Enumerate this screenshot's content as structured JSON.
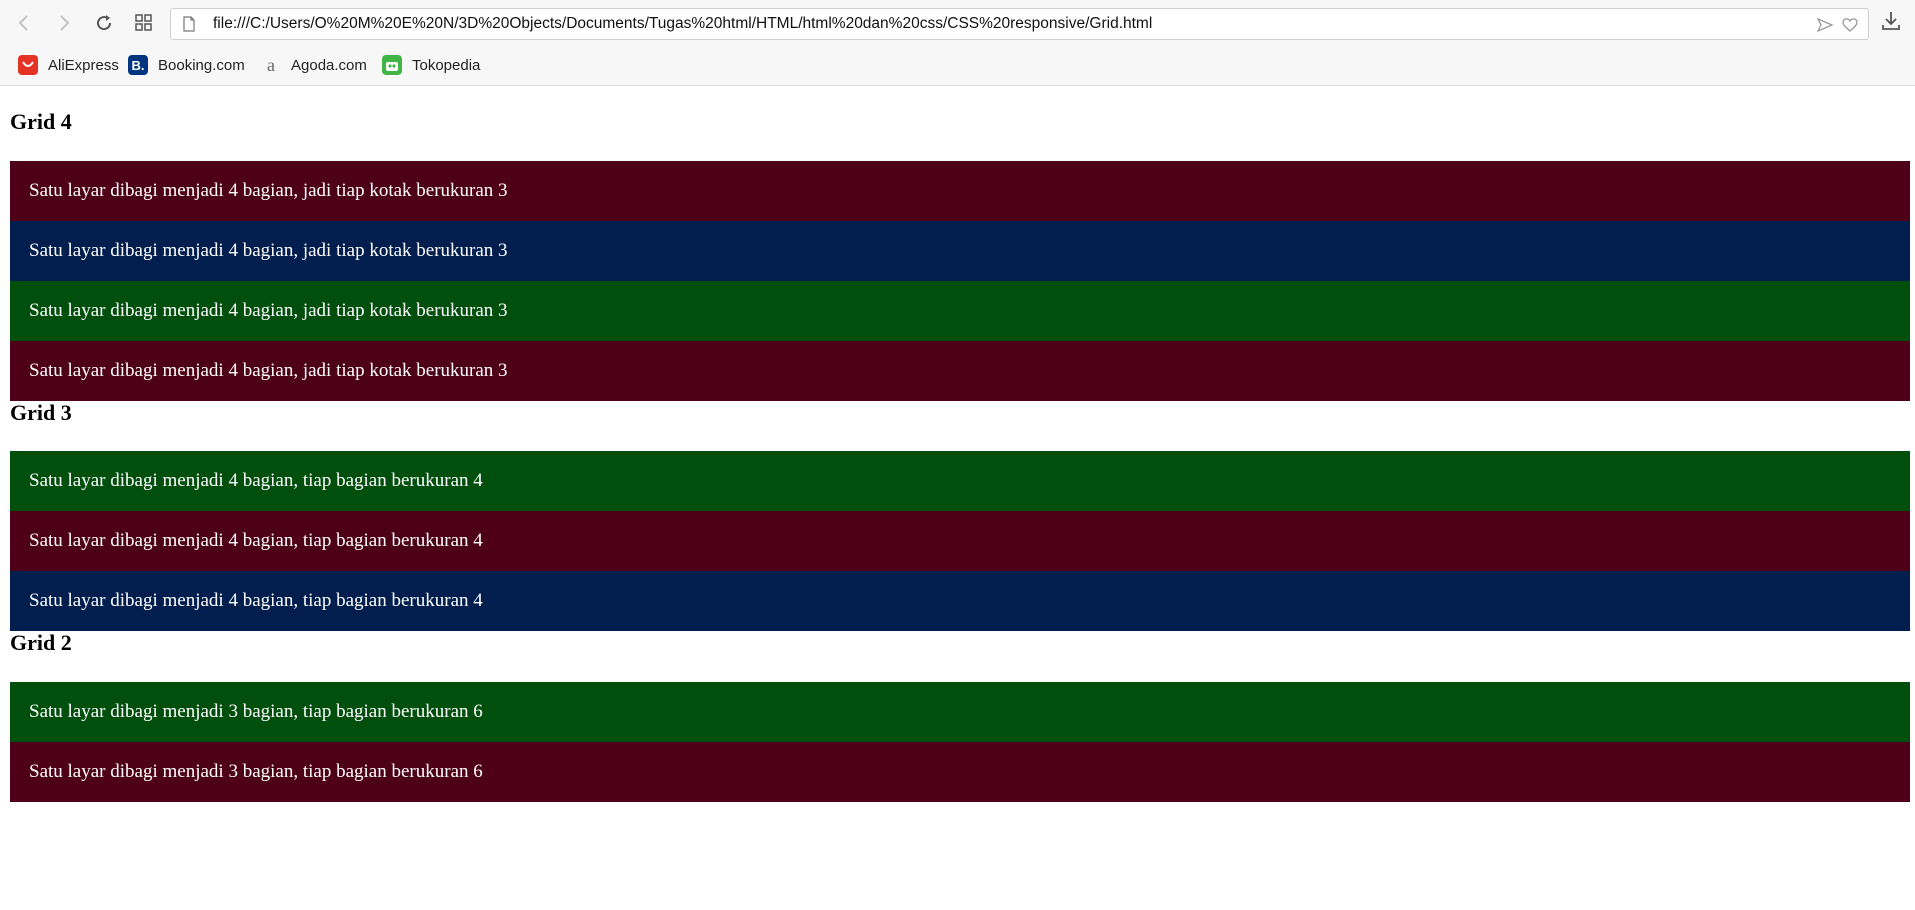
{
  "browser": {
    "address": "file:///C:/Users/O%20M%20E%20N/3D%20Objects/Documents/Tugas%20html/HTML/html%20dan%20css/CSS%20responsive/Grid.html",
    "bookmarks": [
      {
        "label": "AliExpress",
        "icon": "aliexpress-icon",
        "color": "#e43225"
      },
      {
        "label": "Booking.com",
        "icon": "booking-icon",
        "color": "#003580"
      },
      {
        "label": "Agoda.com",
        "icon": "agoda-icon",
        "color": "#888888"
      },
      {
        "label": "Tokopedia",
        "icon": "tokopedia-icon",
        "color": "#42b549"
      }
    ]
  },
  "colors": {
    "maroon": "#4f0019",
    "navy": "#011e4e",
    "green": "#014f0c"
  },
  "sections": [
    {
      "title": "Grid 4",
      "boxes": [
        "Satu layar dibagi menjadi 4 bagian, jadi tiap kotak berukuran 3",
        "Satu layar dibagi menjadi 4 bagian, jadi tiap kotak berukuran 3",
        "Satu layar dibagi menjadi 4 bagian, jadi tiap kotak berukuran 3",
        "Satu layar dibagi menjadi 4 bagian, jadi tiap kotak berukuran 3"
      ]
    },
    {
      "title": "Grid 3",
      "boxes": [
        "Satu layar dibagi menjadi 4 bagian, tiap bagian berukuran 4",
        "Satu layar dibagi menjadi 4 bagian, tiap bagian berukuran 4",
        "Satu layar dibagi menjadi 4 bagian, tiap bagian berukuran 4"
      ]
    },
    {
      "title": "Grid 2",
      "boxes": [
        "Satu layar dibagi menjadi 3 bagian, tiap bagian berukuran 6",
        "Satu layar dibagi menjadi 3 bagian, tiap bagian berukuran 6"
      ]
    }
  ]
}
